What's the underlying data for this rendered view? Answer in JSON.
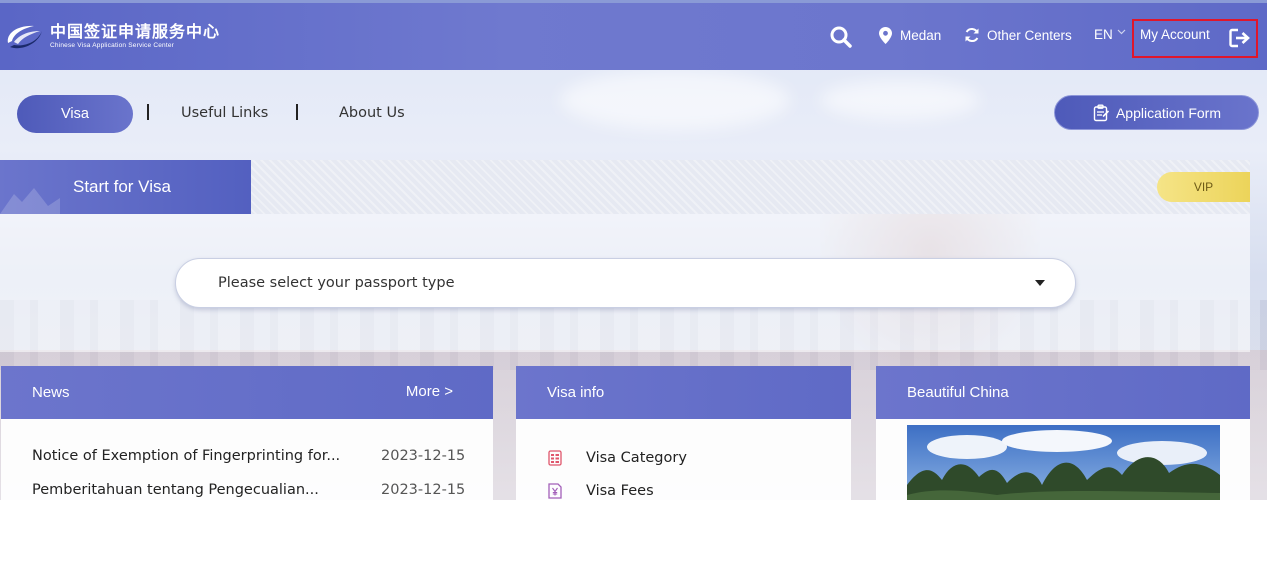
{
  "header": {
    "logo_cn": "中国签证申请服务中心",
    "logo_en": "Chinese Visa Application Service Center",
    "location": "Medan",
    "other_centers": "Other Centers",
    "language": "EN",
    "account": "My Account"
  },
  "nav": {
    "active": "Visa",
    "links": [
      "Useful Links",
      "About Us"
    ],
    "application_form": "Application Form"
  },
  "start": {
    "title": "Start for Visa",
    "vip": "VIP",
    "passport_placeholder": "Please select your passport type"
  },
  "news": {
    "title": "News",
    "more": "More >",
    "items": [
      {
        "title": "Notice of Exemption of Fingerprinting for...",
        "date": "2023-12-15"
      },
      {
        "title": "Pemberitahuan tentang Pengecualian...",
        "date": "2023-12-15"
      }
    ]
  },
  "visa_info": {
    "title": "Visa info",
    "items": [
      "Visa Category",
      "Visa Fees"
    ]
  },
  "beautiful_china": {
    "title": "Beautiful China"
  },
  "colors": {
    "primary": "#5f6ac6",
    "highlight": "#e0162b",
    "vip": "#ecd45a"
  }
}
